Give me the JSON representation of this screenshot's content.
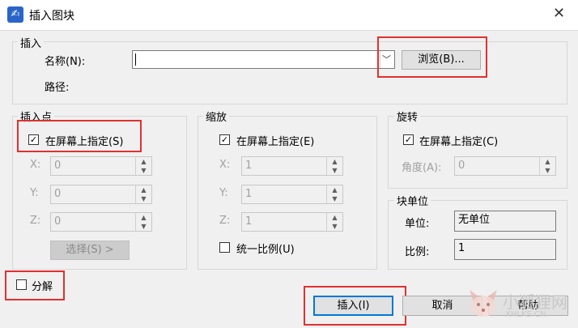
{
  "window": {
    "title": "插入图块",
    "app_icon_glyph": "✍"
  },
  "name_group": {
    "title": "插入",
    "name_label": "名称(N):",
    "name_value": "",
    "browse_button": "浏览(B)...",
    "path_label": "路径:"
  },
  "insert_point": {
    "title": "插入点",
    "specify_on_screen": "在屏幕上指定(S)",
    "specify_checked": true,
    "x_label": "X:",
    "x_value": "0",
    "y_label": "Y:",
    "y_value": "0",
    "z_label": "Z:",
    "z_value": "0",
    "pick_button": "选择(S) >"
  },
  "scale": {
    "title": "缩放",
    "specify_on_screen": "在屏幕上指定(E)",
    "specify_checked": true,
    "x_label": "X:",
    "x_value": "1",
    "y_label": "Y:",
    "y_value": "1",
    "z_label": "Z:",
    "z_value": "1",
    "uniform_label": "统一比例(U)",
    "uniform_checked": false
  },
  "rotation": {
    "title": "旋转",
    "specify_on_screen": "在屏幕上指定(C)",
    "specify_checked": true,
    "angle_label": "角度(A):",
    "angle_value": "0"
  },
  "block_unit": {
    "title": "块单位",
    "unit_label": "单位:",
    "unit_value": "无单位",
    "factor_label": "比例:",
    "factor_value": "1"
  },
  "explode": {
    "label": "分解",
    "checked": false
  },
  "buttons": {
    "insert": "插入(I)",
    "cancel": "取消",
    "help": "帮助"
  },
  "watermark": {
    "text": "小狐狸网",
    "sub": "XHLKS.CN"
  },
  "colors": {
    "highlight_red": "#e23030",
    "focus_blue": "#0078d7"
  }
}
